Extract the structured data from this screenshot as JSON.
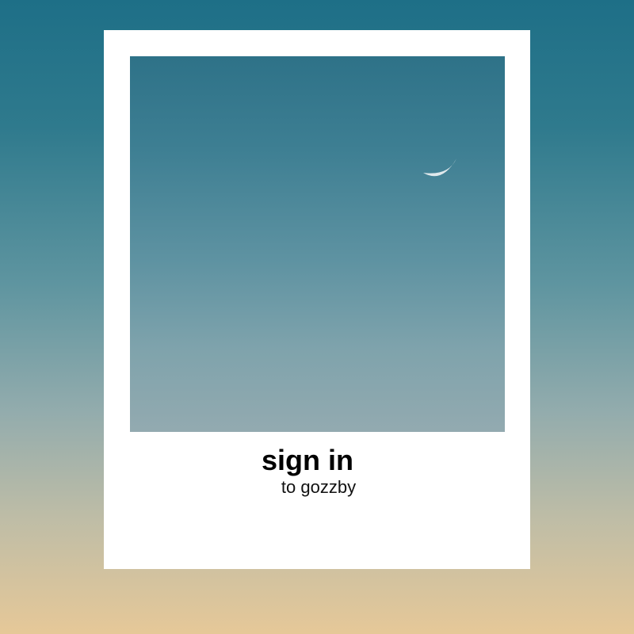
{
  "card": {
    "title": "sign in",
    "subtitle": "to gozzby"
  },
  "photo": {
    "icon": "crescent-moon-icon"
  },
  "colors": {
    "card_background": "#ffffff",
    "title_text": "#000000",
    "sky_top": "#1e6f87",
    "sky_bottom": "#e6c898"
  }
}
